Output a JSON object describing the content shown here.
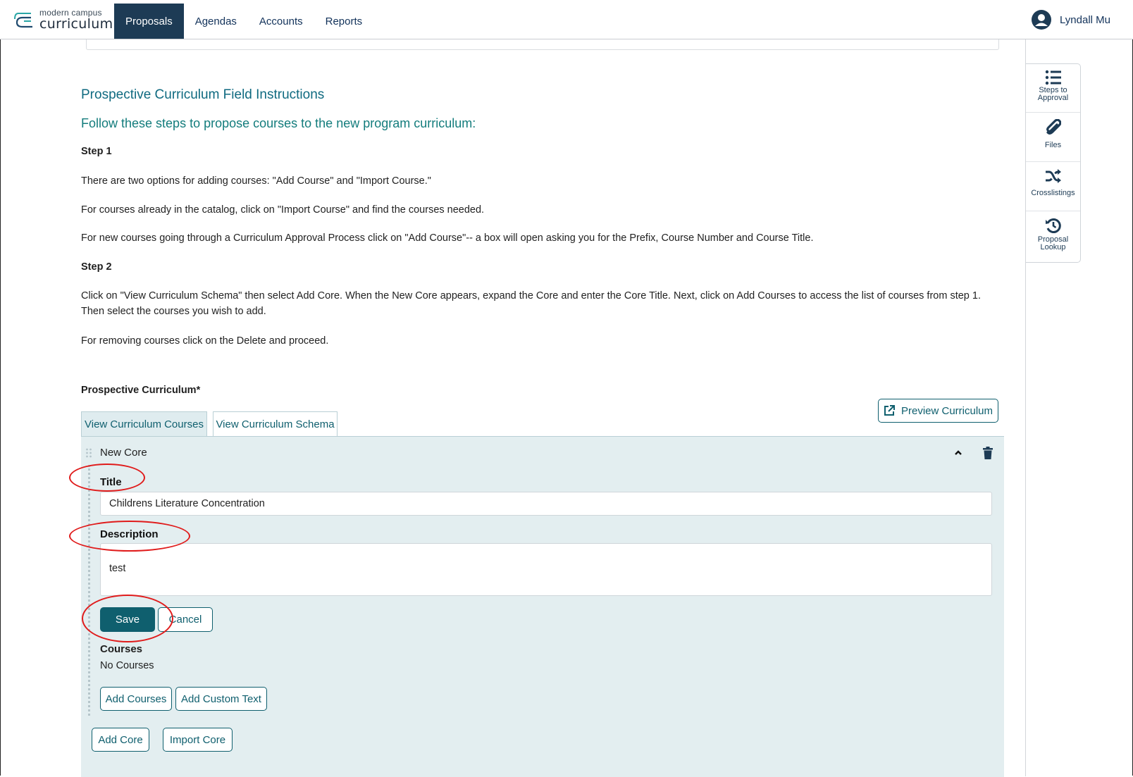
{
  "header": {
    "logo_top": "modern campus",
    "logo_bottom": "curriculum",
    "nav": [
      "Proposals",
      "Agendas",
      "Accounts",
      "Reports"
    ],
    "active_nav": "Proposals",
    "user_name": "Lyndall Mu"
  },
  "instructions": {
    "title": "Prospective Curriculum Field Instructions",
    "subtitle": "Follow these steps to propose courses to the new program curriculum:",
    "step1": "Step 1",
    "p1": "There are two options for adding courses: \"Add Course\" and \"Import Course.\"",
    "p2": "For courses already in the catalog, click on \"Import Course\" and find the courses needed.",
    "p3": "For new courses going through a Curriculum Approval Process click on \"Add Course\"-- a box will open asking you for the Prefix, Course Number and Course Title.",
    "step2": "Step 2",
    "p4": "Click on \"View Curriculum Schema\" then select Add Core. When the New Core appears, expand the Core and enter the Core Title. Next, click on Add Courses to access the list of courses from step 1. Then select the courses you wish to add.",
    "p5": "For removing courses click on the Delete and proceed."
  },
  "curriculum": {
    "label": "Prospective Curriculum*",
    "preview_label": "Preview Curriculum",
    "tabs": [
      "View Curriculum Courses",
      "View Curriculum Schema"
    ],
    "core": {
      "name": "New Core",
      "title_label": "Title",
      "title_value": "Childrens Literature Concentration",
      "description_label": "Description",
      "description_value": "test",
      "save_label": "Save",
      "cancel_label": "Cancel",
      "courses_label": "Courses",
      "no_courses": "No Courses",
      "add_courses_label": "Add Courses",
      "add_custom_text_label": "Add Custom Text"
    },
    "add_core_label": "Add Core",
    "import_core_label": "Import Core"
  },
  "sidebar": {
    "items": [
      {
        "label": "Steps to Approval",
        "icon": "list-icon"
      },
      {
        "label": "Files",
        "icon": "paperclip-icon"
      },
      {
        "label": "Crosslistings",
        "icon": "shuffle-icon"
      },
      {
        "label": "Proposal Lookup",
        "icon": "history-icon"
      }
    ]
  },
  "colors": {
    "primary": "#0f5f6e",
    "nav_active_bg": "#1d3b55",
    "panel_bg": "#e3eef0",
    "annotation": "#e01b1b"
  }
}
